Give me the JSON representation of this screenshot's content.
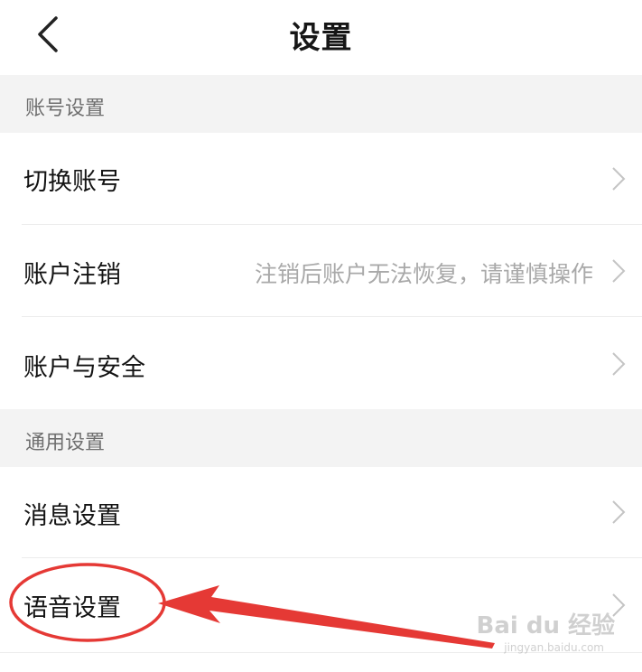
{
  "header": {
    "title": "设置",
    "back_icon": "chevron-left-icon"
  },
  "sections": [
    {
      "label": "账号设置",
      "items": [
        {
          "label": "切换账号",
          "hint": ""
        },
        {
          "label": "账户注销",
          "hint": "注销后账户无法恢复，请谨慎操作"
        },
        {
          "label": "账户与安全",
          "hint": ""
        }
      ]
    },
    {
      "label": "通用设置",
      "items": [
        {
          "label": "消息设置",
          "hint": ""
        },
        {
          "label": "语音设置",
          "hint": ""
        }
      ]
    }
  ],
  "annotation": {
    "color": "#e53935",
    "highlighted_item": "语音设置"
  },
  "watermark": {
    "text": "Bai du 经验",
    "sub": "jingyan.baidu.com"
  },
  "colors": {
    "section_bg": "#f3f3f3",
    "text_primary": "#141414",
    "text_hint": "#a9a9a9",
    "chevron": "#c4c4c4"
  }
}
